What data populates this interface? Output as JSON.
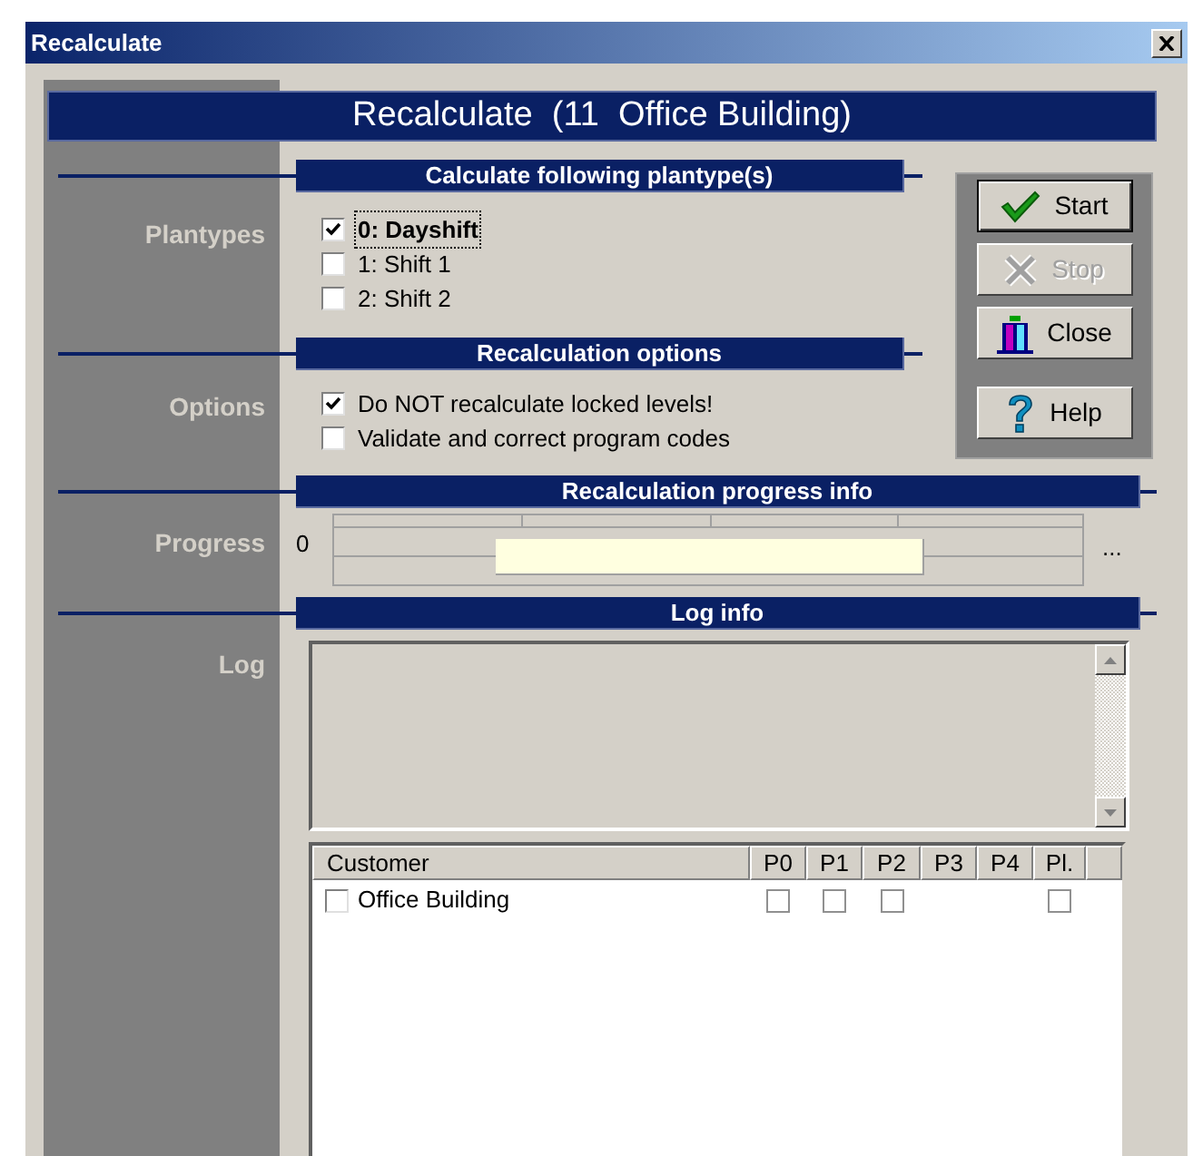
{
  "window": {
    "title": "Recalculate"
  },
  "header": "Recalculate  (11  Office Building)",
  "plantypes": {
    "label": "Plantypes",
    "title": "Calculate following plantype(s)",
    "items": [
      {
        "label": "0: Dayshift",
        "checked": true,
        "focused": true
      },
      {
        "label": "1: Shift 1",
        "checked": false,
        "focused": false
      },
      {
        "label": "2: Shift 2",
        "checked": false,
        "focused": false
      }
    ]
  },
  "options": {
    "label": "Options",
    "title": "Recalculation options",
    "items": [
      {
        "label": "Do NOT recalculate locked levels!",
        "checked": true
      },
      {
        "label": "Validate and correct program codes",
        "checked": false
      }
    ]
  },
  "progress": {
    "label": "Progress",
    "title": "Recalculation progress info",
    "start": "0",
    "end": "..."
  },
  "log": {
    "label": "Log",
    "title": "Log info",
    "table": {
      "columns": [
        "Customer",
        "P0",
        "P1",
        "P2",
        "P3",
        "P4",
        "Pl."
      ],
      "rows": [
        {
          "customer": "Office Building",
          "checked": false,
          "cells": [
            {
              "kind": "checkbox",
              "checked": false
            },
            {
              "kind": "checkbox",
              "checked": false
            },
            {
              "kind": "checkbox",
              "checked": false
            },
            {
              "kind": "empty"
            },
            {
              "kind": "empty"
            },
            {
              "kind": "checkbox",
              "checked": false
            }
          ]
        }
      ]
    }
  },
  "buttons": [
    {
      "label": "Start",
      "kind": "check",
      "default": true,
      "disabled": false
    },
    {
      "label": "Stop",
      "kind": "cross",
      "default": false,
      "disabled": true
    },
    {
      "label": "Close",
      "kind": "door",
      "default": false,
      "disabled": false
    },
    {
      "label": "Help",
      "kind": "question",
      "default": false,
      "disabled": false
    }
  ]
}
